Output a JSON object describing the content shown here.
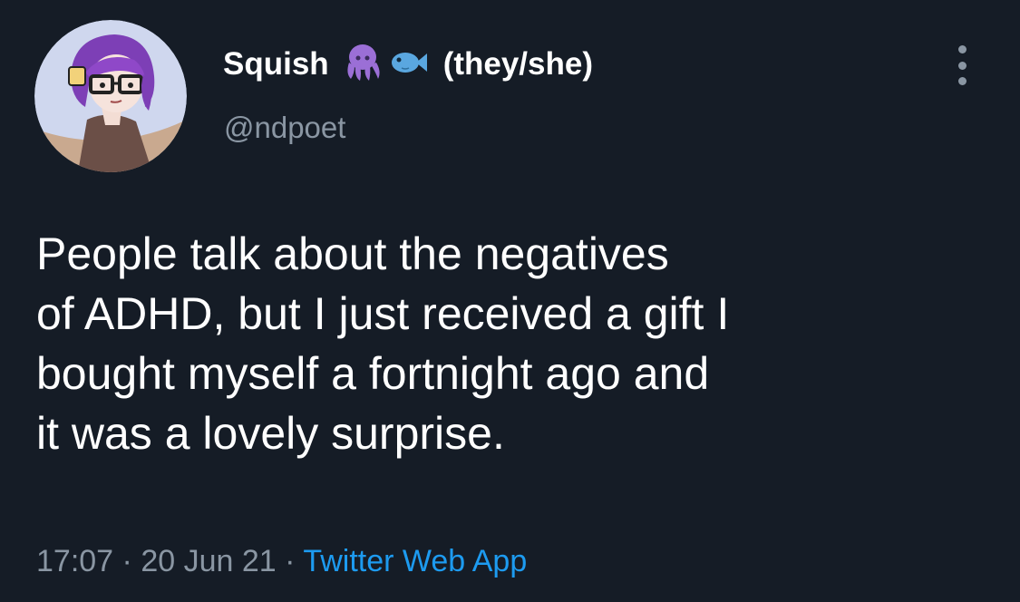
{
  "tweet": {
    "author": {
      "display_name": "Squish",
      "emojis": [
        "octopus-emoji",
        "fish-emoji"
      ],
      "pronouns": "(they/she)",
      "handle": "@ndpoet"
    },
    "text_lines": [
      "People talk about the negatives",
      "of ADHD, but I just received a gift I",
      "bought myself a fortnight ago and",
      "it was a lovely surprise."
    ],
    "time": "17:07",
    "separator": "·",
    "date": "20 Jun 21",
    "source": "Twitter Web App",
    "more_icon": "more-vertical-icon"
  },
  "colors": {
    "background": "#151c26",
    "text": "#ffffff",
    "secondary_text": "#8a96a3",
    "link": "#1d9bf0",
    "octopus": "#9b6fd6",
    "fish": "#5aa7e0"
  }
}
